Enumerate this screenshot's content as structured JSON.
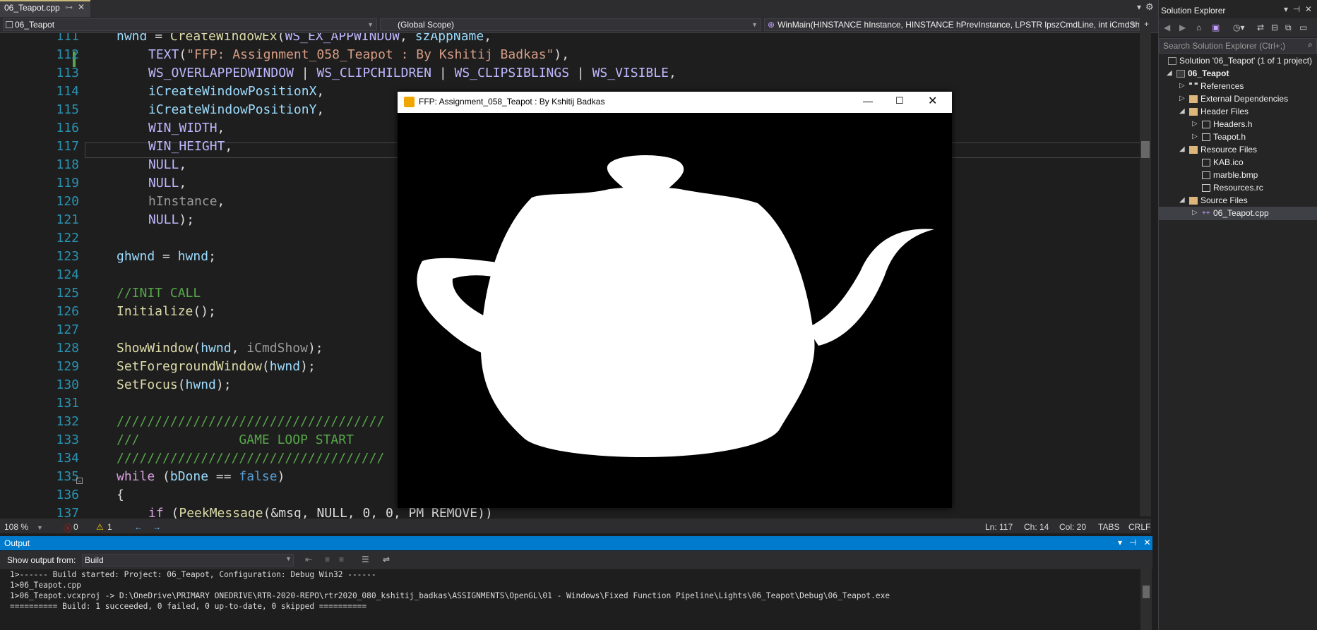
{
  "editor_tab": {
    "filename": "06_Teapot.cpp",
    "pin": "⊶",
    "close": "✕"
  },
  "navbar": {
    "project": "06_Teapot",
    "scope": "(Global Scope)",
    "member": "WinMain(HINSTANCE hInstance, HINSTANCE hPrevInstance, LPSTR lpszCmdLine, int iCmdShow)"
  },
  "code": {
    "line_numbers": [
      "111",
      "112",
      "113",
      "114",
      "115",
      "116",
      "117",
      "118",
      "119",
      "120",
      "121",
      "122",
      "123",
      "124",
      "125",
      "126",
      "127",
      "128",
      "129",
      "130",
      "131",
      "132",
      "133",
      "134",
      "135",
      "136",
      "137"
    ],
    "l111": {
      "a": "hwnd",
      "b": " = ",
      "c": "CreateWindowEx",
      "d": "(",
      "e": "WS_EX_APPWINDOW",
      "f": ", ",
      "g": "szAppName",
      "h": ","
    },
    "l112": {
      "a": "TEXT",
      "b": "(",
      "c": "\"FFP: Assignment_058_Teapot : By Kshitij Badkas\"",
      "d": "),"
    },
    "l113": {
      "a": "WS_OVERLAPPEDWINDOW",
      "b": " | ",
      "c": "WS_CLIPCHILDREN",
      "d": " | ",
      "e": "WS_CLIPSIBLINGS",
      "f": " | ",
      "g": "WS_VISIBLE",
      "h": ","
    },
    "l114": {
      "a": "iCreateWindowPositionX",
      "b": ","
    },
    "l115": {
      "a": "iCreateWindowPositionY",
      "b": ","
    },
    "l116": {
      "a": "WIN_WIDTH",
      "b": ","
    },
    "l117": {
      "a": "WIN_HEIGHT",
      "b": ","
    },
    "l118": {
      "a": "NULL",
      "b": ","
    },
    "l119": {
      "a": "NULL",
      "b": ","
    },
    "l120": {
      "a": "hInstance",
      "b": ","
    },
    "l121": {
      "a": "NULL",
      "b": ");"
    },
    "l123": {
      "a": "ghwnd",
      "b": " = ",
      "c": "hwnd",
      "d": ";"
    },
    "l125": {
      "a": "//INIT CALL"
    },
    "l126": {
      "a": "Initialize",
      "b": "();"
    },
    "l128": {
      "a": "ShowWindow",
      "b": "(",
      "c": "hwnd",
      "d": ", ",
      "e": "iCmdShow",
      "f": ");"
    },
    "l129": {
      "a": "SetForegroundWindow",
      "b": "(",
      "c": "hwnd",
      "d": ");"
    },
    "l130": {
      "a": "SetFocus",
      "b": "(",
      "c": "hwnd",
      "d": ");"
    },
    "l132": {
      "a": "///////////////////////////////////"
    },
    "l133": {
      "a": "///             GAME LOOP START"
    },
    "l134": {
      "a": "///////////////////////////////////"
    },
    "l135": {
      "a": "while",
      "b": " (",
      "c": "bDone",
      "d": " == ",
      "e": "false",
      "f": ")"
    },
    "l136": {
      "a": "{"
    },
    "l137": {
      "a": "if",
      "b": " (",
      "c": "PeekMessage",
      "d": "(&msg, NULL, 0, 0, PM_REMOVE))"
    }
  },
  "status": {
    "zoom": "108 %",
    "errors": "0",
    "warnings": "1",
    "ln": "Ln: 117",
    "ch": "Ch: 14",
    "col": "Col: 20",
    "tabs": "TABS",
    "crlf": "CRLF"
  },
  "output": {
    "title": "Output",
    "show_from_label": "Show output from:",
    "source": "Build",
    "lines": [
      "1>------ Build started: Project: 06_Teapot, Configuration: Debug Win32 ------",
      "1>06_Teapot.cpp",
      "1>06_Teapot.vcxproj -> D:\\OneDrive\\PRIMARY ONEDRIVE\\RTR-2020-REPO\\rtr2020_080_kshitij_badkas\\ASSIGNMENTS\\OpenGL\\01 - Windows\\Fixed Function Pipeline\\Lights\\06_Teapot\\Debug\\06_Teapot.exe",
      "========== Build: 1 succeeded, 0 failed, 0 up-to-date, 0 skipped =========="
    ]
  },
  "solution_explorer": {
    "title": "Solution Explorer",
    "search_placeholder": "Search Solution Explorer (Ctrl+;)",
    "items": [
      {
        "label": "Solution '06_Teapot' (1 of 1 project)"
      },
      {
        "label": "06_Teapot"
      },
      {
        "label": "References"
      },
      {
        "label": "External Dependencies"
      },
      {
        "label": "Header Files"
      },
      {
        "label": "Headers.h"
      },
      {
        "label": "Teapot.h"
      },
      {
        "label": "Resource Files"
      },
      {
        "label": "KAB.ico"
      },
      {
        "label": "marble.bmp"
      },
      {
        "label": "Resources.rc"
      },
      {
        "label": "Source Files"
      },
      {
        "label": "06_Teapot.cpp"
      }
    ]
  },
  "app_window": {
    "title": "FFP: Assignment_058_Teapot : By Kshitij Badkas",
    "minimize": "—",
    "maximize": "☐",
    "close": "✕"
  },
  "colors": {
    "accent": "#007acc",
    "keyword": "#569cd6",
    "function": "#dcdcaa",
    "string": "#d69d85",
    "macro": "#beb7ff",
    "variable": "#9cdcfe",
    "comment": "#57a64a",
    "line_number": "#2b91af"
  }
}
